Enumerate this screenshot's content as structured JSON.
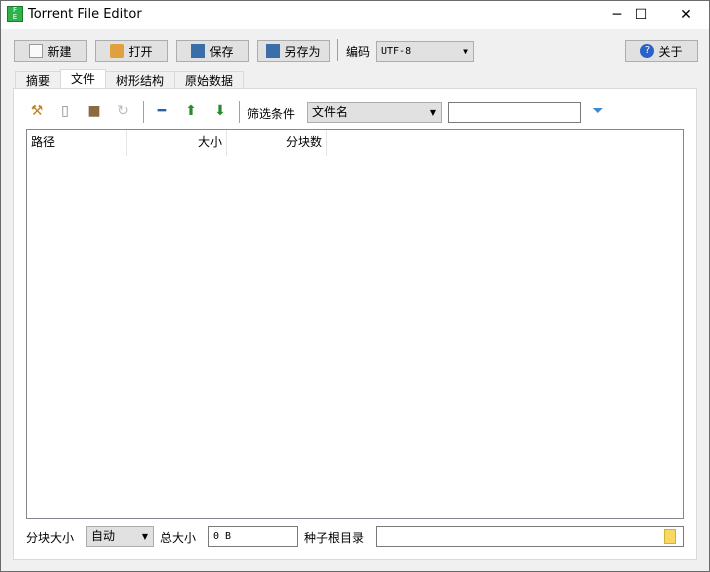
{
  "window": {
    "title": "Torrent File Editor",
    "minimize": "─",
    "maximize": "☐",
    "close": "✕"
  },
  "toolbar": {
    "new": "新建",
    "open": "打开",
    "save": "保存",
    "save_as": "另存为",
    "encoding_label": "编码",
    "encoding_value": "UTF-8",
    "about": "关于"
  },
  "tabs": [
    "摘要",
    "文件",
    "树形结构",
    "原始数据"
  ],
  "files": {
    "filter_label": "筛选条件",
    "filter_field": "文件名",
    "filter_value": "",
    "columns": [
      "路径",
      "大小",
      "分块数"
    ]
  },
  "footer": {
    "piece_size_label": "分块大小",
    "piece_size_value": "自动",
    "total_size_label": "总大小",
    "total_size_value": "0 B",
    "root_dir_label": "种子根目录",
    "root_dir_value": ""
  }
}
